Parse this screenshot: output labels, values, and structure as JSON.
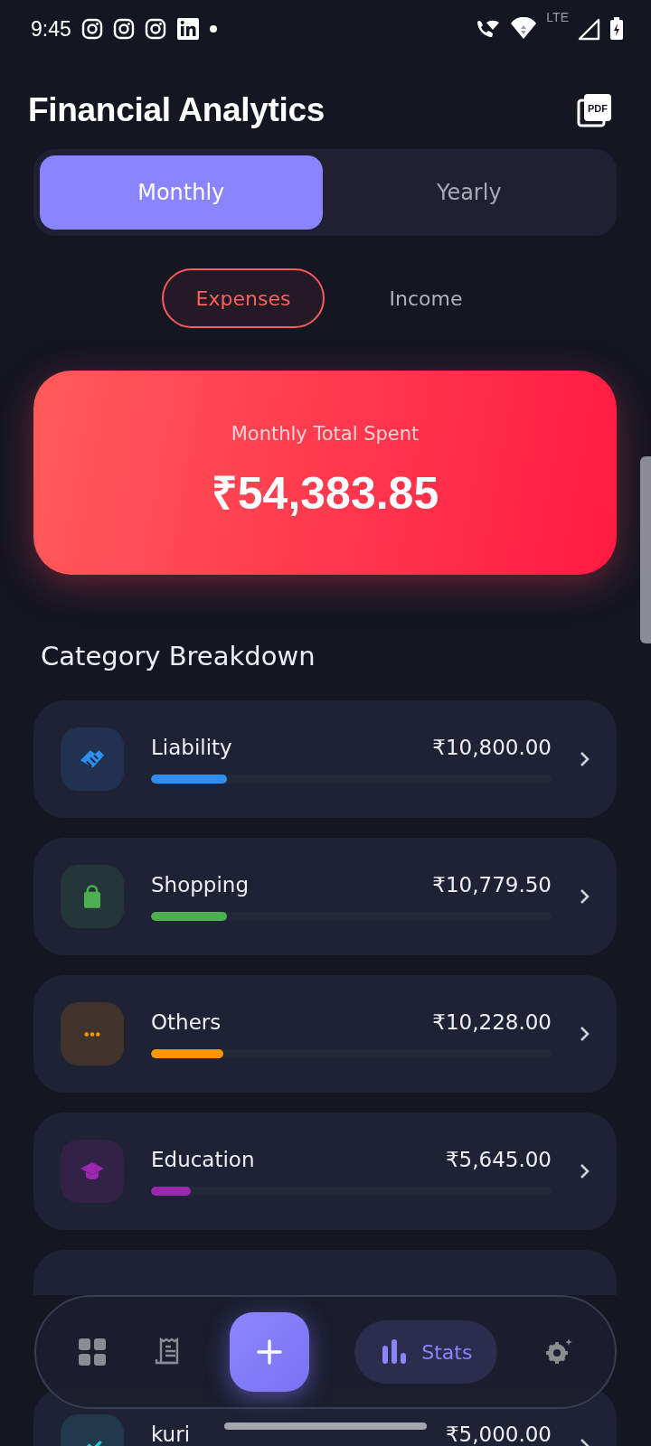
{
  "status_bar": {
    "time": "9:45",
    "network": "LTE"
  },
  "header": {
    "title": "Financial Analytics",
    "export_label": "PDF"
  },
  "period_tabs": [
    {
      "label": "Monthly",
      "selected": true
    },
    {
      "label": "Yearly",
      "selected": false
    }
  ],
  "type_tabs": [
    {
      "label": "Expenses",
      "selected": true
    },
    {
      "label": "Income",
      "selected": false
    }
  ],
  "total": {
    "label": "Monthly Total Spent",
    "amount": "₹54,383.85"
  },
  "section_title": "Category Breakdown",
  "categories": [
    {
      "kind": "full",
      "name": "Liability",
      "amount": "₹10,800.00",
      "level": 0.19,
      "color": "#2f8ff0"
    },
    {
      "kind": "full",
      "name": "Shopping",
      "amount": "₹10,779.50",
      "level": 0.19,
      "color": "#4caf50"
    },
    {
      "kind": "full",
      "name": "Others",
      "amount": "₹10,228.00",
      "level": 0.18,
      "color": "#ff9800"
    },
    {
      "kind": "full",
      "name": "Education",
      "amount": "₹5,645.00",
      "level": 0.1,
      "color": "#9c27b0"
    },
    {
      "kind": "obscured"
    },
    {
      "kind": "full",
      "name": "kuri",
      "amount": "₹5,000.00",
      "color": "#26c6da"
    }
  ],
  "nav": [
    {
      "kind": "grid",
      "selected": false
    },
    {
      "kind": "receipt",
      "selected": false
    },
    {
      "kind": "add",
      "selected": false
    },
    {
      "kind": "stats",
      "label": "Stats",
      "selected": true
    },
    {
      "kind": "settings",
      "selected": false
    }
  ]
}
